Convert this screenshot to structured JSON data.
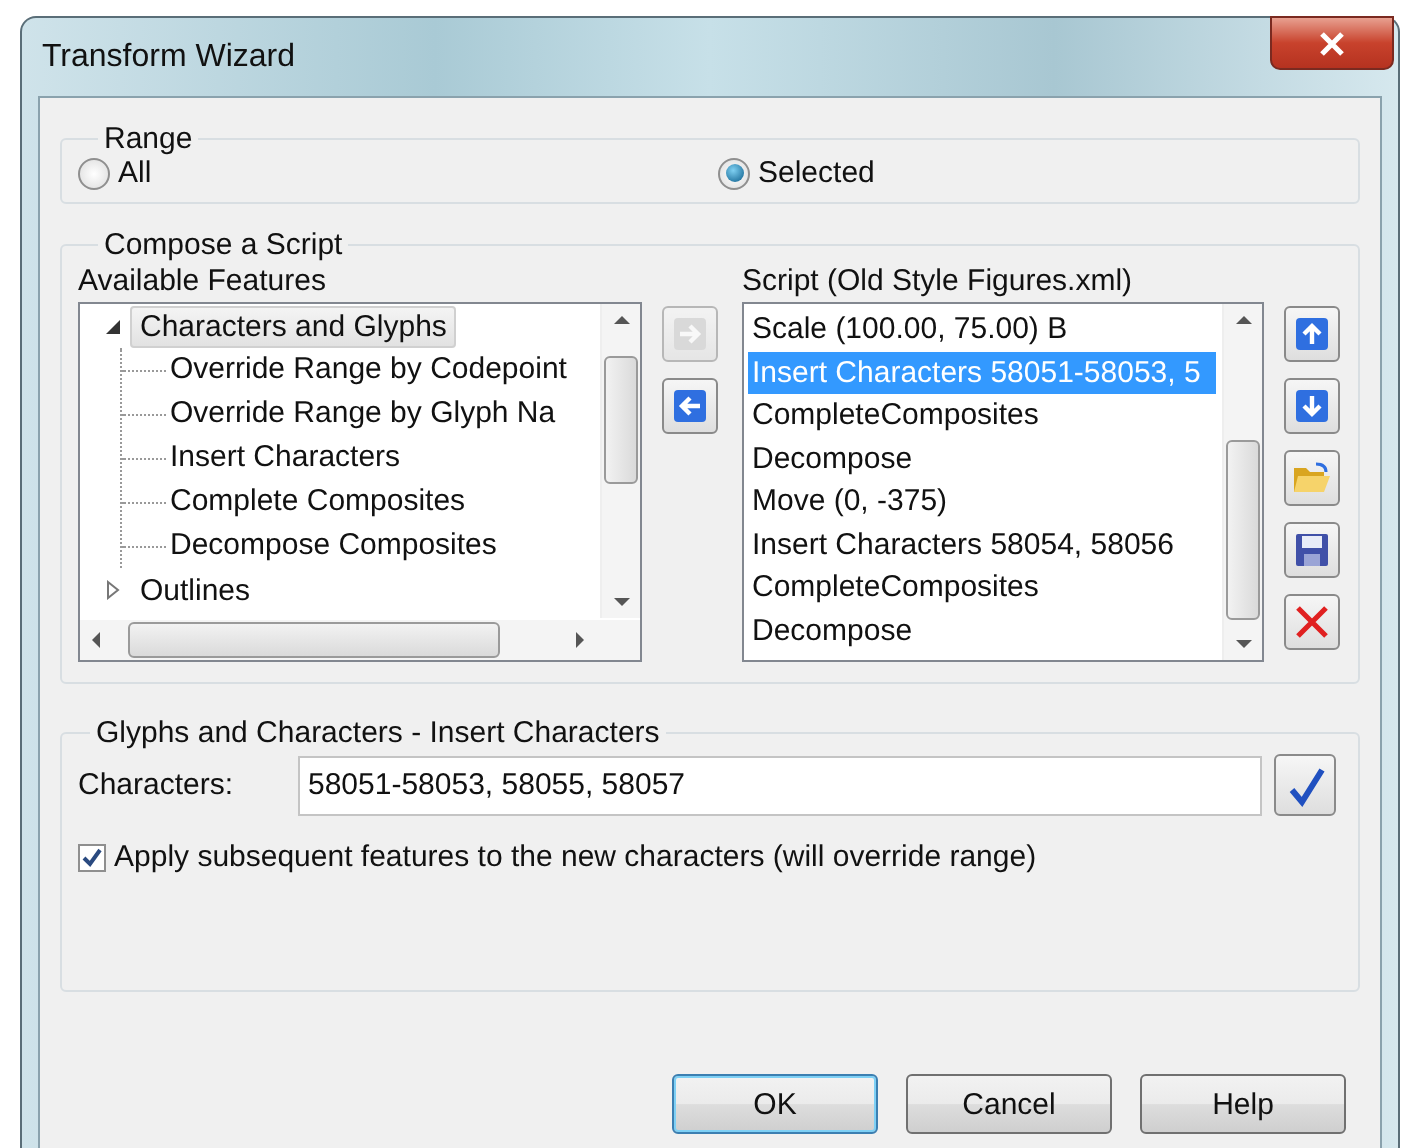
{
  "window": {
    "title": "Transform Wizard"
  },
  "range": {
    "label": "Range",
    "options": [
      {
        "label": "All",
        "selected": false
      },
      {
        "label": "Selected",
        "selected": true
      }
    ]
  },
  "compose": {
    "label": "Compose a Script",
    "features": {
      "label": "Available Features",
      "tree": [
        {
          "label": "Characters and Glyphs",
          "selected": true,
          "expanded": true,
          "children": [
            {
              "label": "Override Range by Codepoint"
            },
            {
              "label": "Override Range by Glyph Na"
            },
            {
              "label": "Insert Characters"
            },
            {
              "label": "Complete Composites"
            },
            {
              "label": "Decompose Composites"
            }
          ]
        },
        {
          "label": "Outlines",
          "selected": false,
          "expanded": false
        }
      ]
    },
    "move_buttons": [
      {
        "kind": "add",
        "disabled": true
      },
      {
        "kind": "remove",
        "disabled": false
      }
    ],
    "script": {
      "label": "Script (Old Style Figures.xml)",
      "items": [
        {
          "label": "Scale (100.00, 75.00) B",
          "selected": false
        },
        {
          "label": "Insert Characters 58051-58053, 5",
          "selected": true
        },
        {
          "label": "CompleteComposites",
          "selected": false
        },
        {
          "label": "Decompose",
          "selected": false
        },
        {
          "label": "Move (0, -375)",
          "selected": false
        },
        {
          "label": "Insert Characters 58054, 58056",
          "selected": false
        },
        {
          "label": "CompleteComposites",
          "selected": false
        },
        {
          "label": "Decompose",
          "selected": false
        }
      ]
    },
    "tools": [
      {
        "kind": "up"
      },
      {
        "kind": "down"
      },
      {
        "kind": "open"
      },
      {
        "kind": "save"
      },
      {
        "kind": "delete"
      }
    ]
  },
  "insert": {
    "label": "Glyphs and Characters - Insert Characters",
    "field_label": "Characters:",
    "value": "58051-58053, 58055, 58057",
    "option": {
      "label": "Apply subsequent features to the new characters (will override range)",
      "checked": true
    }
  },
  "buttons": [
    {
      "label": "OK",
      "default": true
    },
    {
      "label": "Cancel",
      "default": false
    },
    {
      "label": "Help",
      "default": false
    }
  ]
}
